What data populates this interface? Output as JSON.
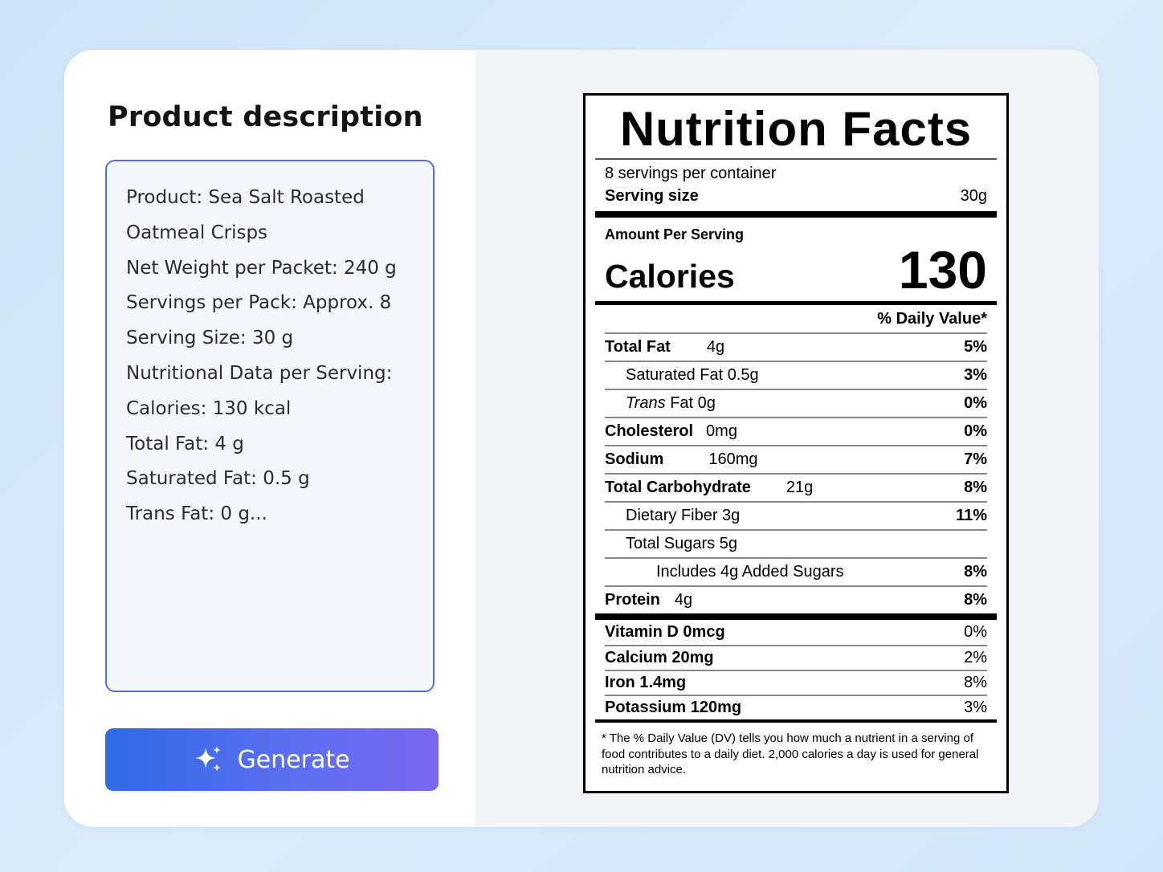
{
  "left": {
    "title": "Product description",
    "lines": [
      "Product: Sea Salt Roasted",
      "Oatmeal Crisps",
      "Net Weight per Packet: 240 g",
      "Servings per Pack: Approx. 8",
      "Serving Size: 30 g",
      "Nutritional Data per Serving:",
      "Calories: 130 kcal",
      "Total Fat: 4 g",
      "Saturated Fat: 0.5 g",
      "Trans Fat: 0 g..."
    ],
    "button": {
      "label": "Generate",
      "icon": "sparkle-icon"
    }
  },
  "label": {
    "title": "Nutrition Facts",
    "servings": "8 servings per container",
    "serving_size_label": "Serving size",
    "serving_size_value": "30g",
    "amount_per_serving": "Amount Per Serving",
    "calories_label": "Calories",
    "calories_value": "130",
    "dv_header": "% Daily Value*",
    "nutrients": [
      {
        "name": "Total Fat",
        "amount": "4g",
        "pct": "5%"
      },
      {
        "name": "Saturated Fat 0.5g",
        "pct": "3%"
      },
      {
        "name_italic": "Trans",
        "name_rest": " Fat 0g",
        "pct": "0%"
      },
      {
        "name": "Cholesterol",
        "amount": "0mg",
        "pct": "0%"
      },
      {
        "name": "Sodium",
        "amount": "160mg",
        "pct": "7%"
      },
      {
        "name": "Total Carbohydrate",
        "amount": "21g",
        "pct": "8%"
      },
      {
        "name": "Dietary Fiber 3g",
        "pct": "11%"
      },
      {
        "name": "Total Sugars 5g",
        "pct": ""
      },
      {
        "name": "Includes 4g Added Sugars",
        "pct": "8%"
      },
      {
        "name": "Protein",
        "amount": "4g",
        "pct": "8%"
      }
    ],
    "vitamins": [
      {
        "name": "Vitamin D 0mcg",
        "pct": "0%"
      },
      {
        "name": "Calcium 20mg",
        "pct": "2%"
      },
      {
        "name": "Iron 1.4mg",
        "pct": "8%"
      },
      {
        "name": "Potassium 120mg",
        "pct": "3%"
      }
    ],
    "footnote": "* The % Daily Value (DV) tells you how much a nutrient in a serving of food contributes to a daily diet. 2,000 calories a day is used for general nutrition advice."
  }
}
